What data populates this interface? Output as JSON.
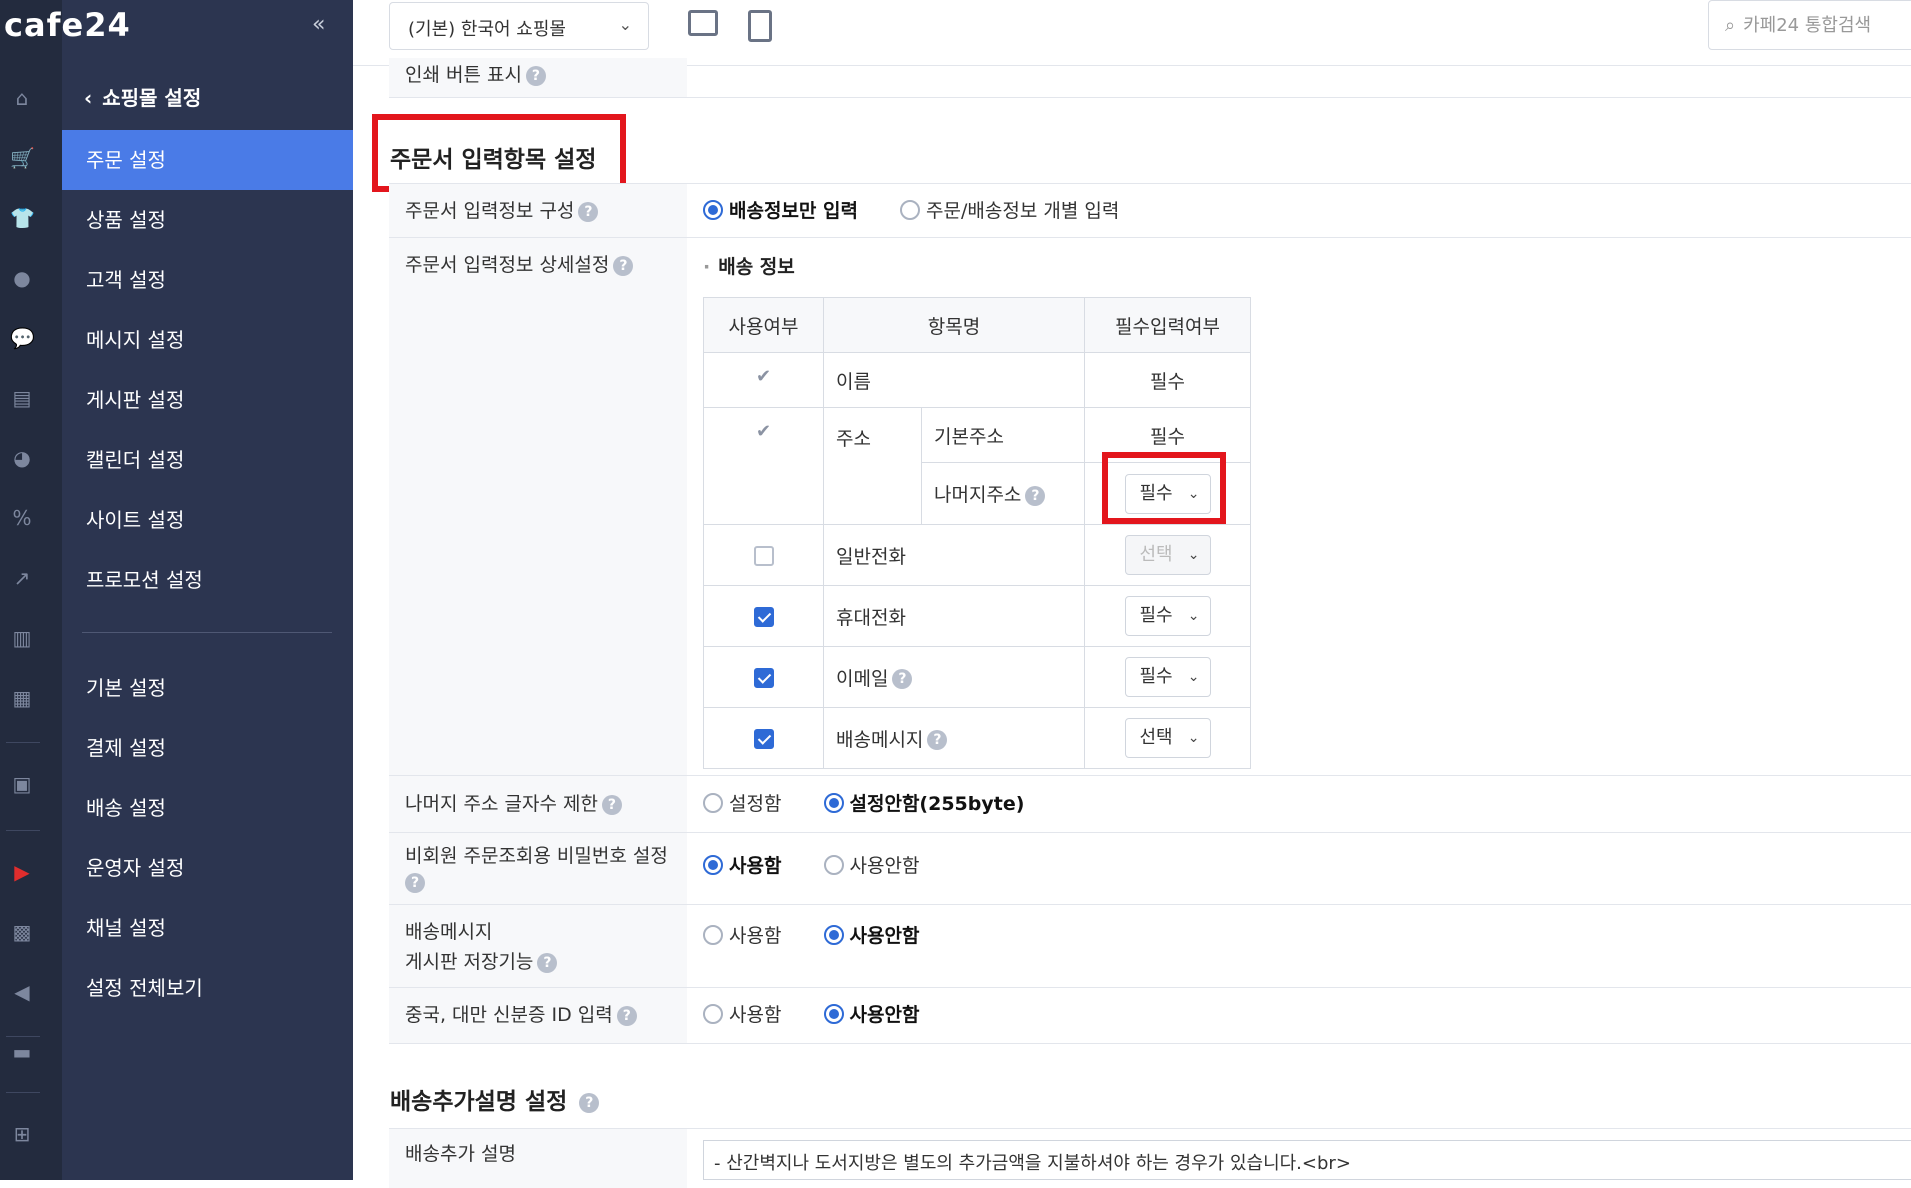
{
  "brand": {
    "logo": "cafe24",
    "collapse_icon": "double-chevron-left-icon"
  },
  "rail_icons": [
    "home-icon",
    "cart-icon",
    "shirt-icon",
    "user-icon",
    "chat-icon",
    "board-icon",
    "palette-icon",
    "coupon-icon",
    "chart-line-icon",
    "chart-bar-icon",
    "excel-icon",
    "app-icon",
    "youtube-icon",
    "toolbox-icon",
    "megaphone-icon",
    "store-icon",
    "grid-plus-icon"
  ],
  "menu": {
    "header": "쇼핑몰 설정",
    "items": [
      "주문 설정",
      "상품 설정",
      "고객 설정",
      "메시지 설정",
      "게시판 설정",
      "캘린더 설정",
      "사이트 설정",
      "프로모션 설정"
    ],
    "items2": [
      "기본 설정",
      "결제 설정",
      "배송 설정",
      "운영자 설정",
      "채널 설정",
      "설정 전체보기"
    ],
    "active": "주문 설정"
  },
  "topbar": {
    "shop_select": "(기본) 한국어 쇼핑몰",
    "search_placeholder": "카페24 통합검색"
  },
  "content": {
    "prev_row_label": "인쇄 버튼 표시",
    "section1_title": "주문서 입력항목 설정",
    "row1": {
      "label": "주문서 입력정보 구성",
      "opt1": "배송정보만 입력",
      "opt2": "주문/배송정보 개별 입력"
    },
    "row2": {
      "label": "주문서 입력정보 상세설정",
      "subhead": "배송 정보",
      "table": {
        "headers": [
          "사용여부",
          "항목명",
          "필수입력여부"
        ],
        "name": "이름",
        "name_req": "필수",
        "addr": "주소",
        "addr_basic": "기본주소",
        "addr_basic_req": "필수",
        "addr_rest": "나머지주소",
        "addr_rest_req": "필수",
        "phone": "일반전화",
        "phone_req": "선택",
        "mobile": "휴대전화",
        "mobile_req": "필수",
        "email": "이메일",
        "email_req": "필수",
        "msg": "배송메시지",
        "msg_req": "선택"
      }
    },
    "row3": {
      "label": "나머지 주소 글자수 제한",
      "opt1": "설정함",
      "opt2": "설정안함(255byte)"
    },
    "row4": {
      "label": "비회원 주문조회용 비밀번호 설정",
      "opt1": "사용함",
      "opt2": "사용안함"
    },
    "row5": {
      "label1": "배송메시지",
      "label2": "게시판 저장기능",
      "opt1": "사용함",
      "opt2": "사용안함"
    },
    "row6": {
      "label": "중국, 대만 신분증 ID 입력",
      "opt1": "사용함",
      "opt2": "사용안함"
    },
    "section2_title": "배송추가설명 설정",
    "row7": {
      "label": "배송추가 설명",
      "value": "- 산간벽지나 도서지방은 별도의 추가금액을 지불하셔야 하는 경우가 있습니다.<br>"
    }
  },
  "colors": {
    "accent": "#4a7be7",
    "sidebar": "#2c3550",
    "highlight": "#e3161d"
  }
}
